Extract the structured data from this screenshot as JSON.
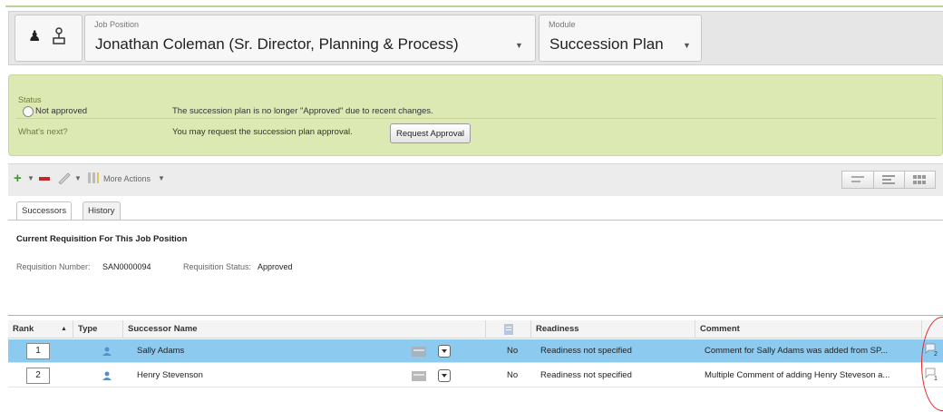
{
  "header": {
    "job_label": "Job Position",
    "job_value": "Jonathan Coleman (Sr. Director, Planning & Process)",
    "module_label": "Module",
    "module_value": "Succession Plan"
  },
  "status": {
    "label": "Status",
    "value": "Not approved",
    "message": "The succession plan is no longer \"Approved\" due to recent changes.",
    "next_label": "What's next?",
    "next_message": "You may request the succession plan approval.",
    "button_label": "Request Approval"
  },
  "toolbar": {
    "more_actions_label": "More Actions"
  },
  "tabs": [
    {
      "label": "Successors"
    },
    {
      "label": "History"
    }
  ],
  "requisition": {
    "title": "Current Requisition For This Job Position",
    "number_label": "Requisition Number:",
    "number_value": "SAN0000094",
    "status_label": "Requisition Status:",
    "status_value": "Approved"
  },
  "table": {
    "columns": [
      "Rank",
      "Type",
      "Successor Name",
      "Readiness",
      "Comment"
    ],
    "rows": [
      {
        "rank": "1",
        "name": "Sally Adams",
        "flag": "No",
        "readiness": "Readiness not specified",
        "comment": "Comment for Sally Adams was added from SP...",
        "comment_count": "2",
        "selected": true
      },
      {
        "rank": "2",
        "name": "Henry Stevenson",
        "flag": "No",
        "readiness": "Readiness not specified",
        "comment": "Multiple Comment of adding Henry Steveson a...",
        "comment_count": "1",
        "selected": false
      }
    ]
  },
  "colors": {
    "status_panel_bg": "#dde9b3",
    "selected_row_bg": "#8dcaf0",
    "annotation_red": "#e0262a"
  }
}
